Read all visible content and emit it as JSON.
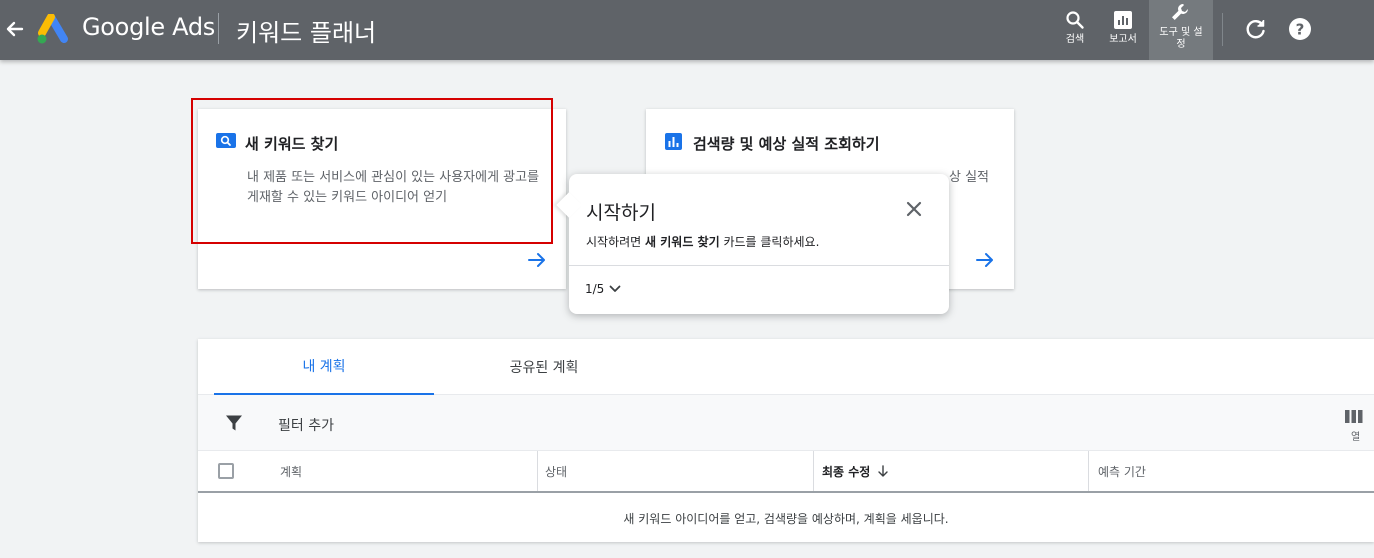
{
  "header": {
    "brand": "Google Ads",
    "page_title": "키워드 플래너",
    "search_label": "검색",
    "reports_label": "보고서",
    "tools_label": "도구 및 설\n정"
  },
  "cards": [
    {
      "title": "새 키워드 찾기",
      "description": "내 제품 또는 서비스에 관심이 있는 사용자에게 광고를 게재할 수 있는 키워드 아이디어 얻기"
    },
    {
      "title": "검색량 및 예상 실적 조회하기",
      "description_visible_tail": "상 실적"
    }
  ],
  "tooltip": {
    "title": "시작하기",
    "body_prefix": "시작하려면 ",
    "body_bold": "새 키워드 찾기",
    "body_suffix": " 카드를 클릭하세요.",
    "pager": "1/5"
  },
  "plans": {
    "tabs": [
      "내 계획",
      "공유된 계획"
    ],
    "filter_label": "필터 추가",
    "columns_label": "열",
    "columns": [
      "계획",
      "상태",
      "최종 수정",
      "예측 기간"
    ],
    "empty_message": "새 키워드 아이디어를 얻고, 검색량을 예상하며, 계획을 세웁니다."
  },
  "colors": {
    "topbar": "#5f6368",
    "accent_blue": "#1a73e8",
    "highlight_red": "#d50000"
  }
}
